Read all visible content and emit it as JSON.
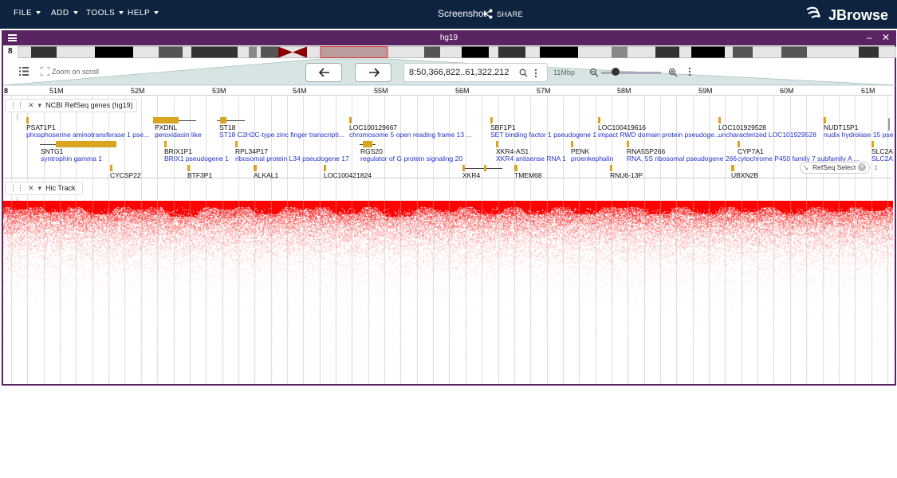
{
  "topbar": {
    "menus": [
      {
        "label": "FILE"
      },
      {
        "label": "ADD"
      },
      {
        "label": "TOOLS"
      },
      {
        "label": "HELP"
      }
    ],
    "session_title": "Screenshot",
    "share_label": "SHARE",
    "logo_text": "JBrowse"
  },
  "view": {
    "title": "hg19",
    "chromosome": "8",
    "zoom_on_scroll_label": "Zoom on scroll",
    "location": "8:50,366,822..61,322,212",
    "bp_per_view": "11Mbp",
    "ruler_labels": [
      "51M",
      "52M",
      "53M",
      "54M",
      "55M",
      "56M",
      "57M",
      "58M",
      "59M",
      "60M",
      "61M"
    ]
  },
  "tracks": {
    "refseq": {
      "title": "NCBI RefSeq genes (hg19)",
      "genes_row1": [
        {
          "name": "PSAT1P1",
          "desc": "phosphoserine aminotransferase 1 pse..."
        },
        {
          "name": "PXDNL",
          "desc": "peroxidasin like"
        },
        {
          "name": "ST18",
          "desc": "ST18 C2H2C-type zinc finger transcripti..."
        },
        {
          "name": "LOC100129667",
          "desc": "chromosome 5 open reading frame 13 ..."
        },
        {
          "name": "SBF1P1",
          "desc": "SET binding factor 1 pseudogene 1"
        },
        {
          "name": "LOC100419616",
          "desc": "impact RWD domain protein pseudoge..."
        },
        {
          "name": "LOC101929528",
          "desc": "uncharacterized LOC101929528"
        },
        {
          "name": "NUDT15P1",
          "desc": "nudix hydrolase 15 pse"
        }
      ],
      "genes_row2": [
        {
          "name": "SNTG1",
          "desc": "syntrophin gamma 1"
        },
        {
          "name": "BRIX1P1",
          "desc": "BRIX1 pseudogene 1"
        },
        {
          "name": "RPL34P17",
          "desc": "ribosomal protein L34 pseudogene 17"
        },
        {
          "name": "RGS20",
          "desc": "regulator of G protein signaling 20"
        },
        {
          "name": "XKR4-AS1",
          "desc": "XKR4 antisense RNA 1"
        },
        {
          "name": "PENK",
          "desc": "proenkephalin"
        },
        {
          "name": "RNA5SP266",
          "desc": "RNA, 5S ribosomal pseudogene 266"
        },
        {
          "name": "CYP7A1",
          "desc": "cytochrome P450 family 7 subfamily A ..."
        },
        {
          "name": "SLC2A",
          "desc": "SLC2A"
        }
      ],
      "genes_row3": [
        {
          "name": "CYCSP22"
        },
        {
          "name": "BTF3P1"
        },
        {
          "name": "ALKAL1"
        },
        {
          "name": "LOC100421824"
        },
        {
          "name": "XKR4"
        },
        {
          "name": "TMEM68"
        },
        {
          "name": "RNU6-13P"
        },
        {
          "name": "UBXN2B"
        }
      ],
      "select_chip_label": "RefSeq Select"
    },
    "hic": {
      "title": "Hic Track"
    }
  },
  "colors": {
    "topbar": "#0d233f",
    "view_frame": "#5a2463",
    "hic": "#ff0000",
    "gene_feature": "#d9a520",
    "gene_desc": "#2233cc"
  }
}
